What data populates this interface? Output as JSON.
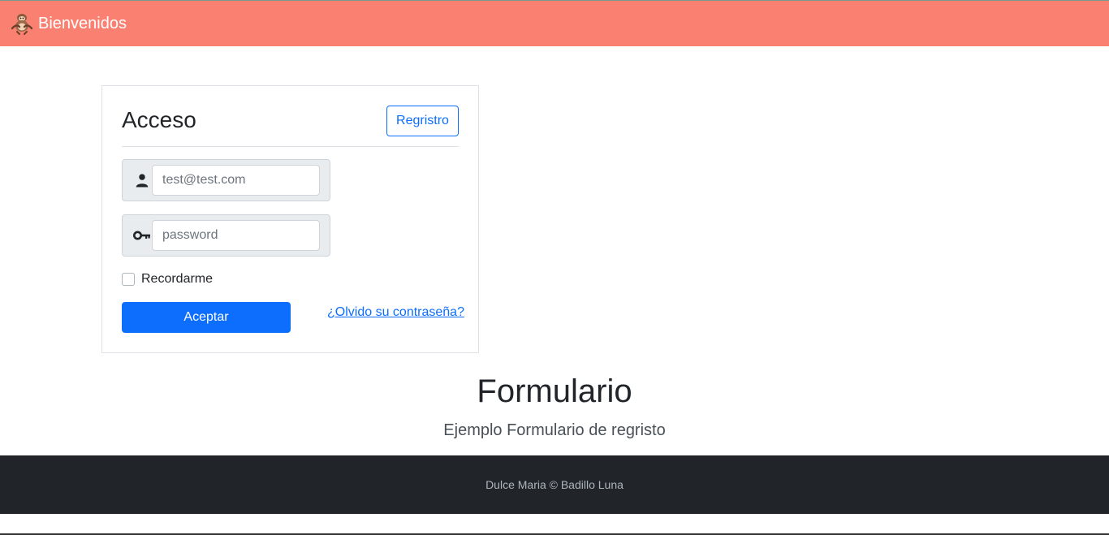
{
  "navbar": {
    "brand_label": "Bienvenidos",
    "brand_icon": "sloth-logo-icon",
    "background_color": "#fa8072"
  },
  "login_card": {
    "title": "Acceso",
    "register_button_label": "Regristro",
    "email_field": {
      "icon": "user-icon",
      "placeholder": "test@test.com",
      "value": ""
    },
    "password_field": {
      "icon": "key-icon",
      "placeholder": "password",
      "value": ""
    },
    "remember_label": "Recordarme",
    "remember_checked": false,
    "submit_label": "Aceptar",
    "forgot_link_label": "¿Olvido su contraseña?",
    "accent_color": "#0d6efd"
  },
  "hero": {
    "title": "Formulario",
    "subtitle": "Ejemplo Formulario de regristo"
  },
  "footer": {
    "text": "Dulce Maria © Badillo Luna",
    "background_color": "#212529"
  }
}
